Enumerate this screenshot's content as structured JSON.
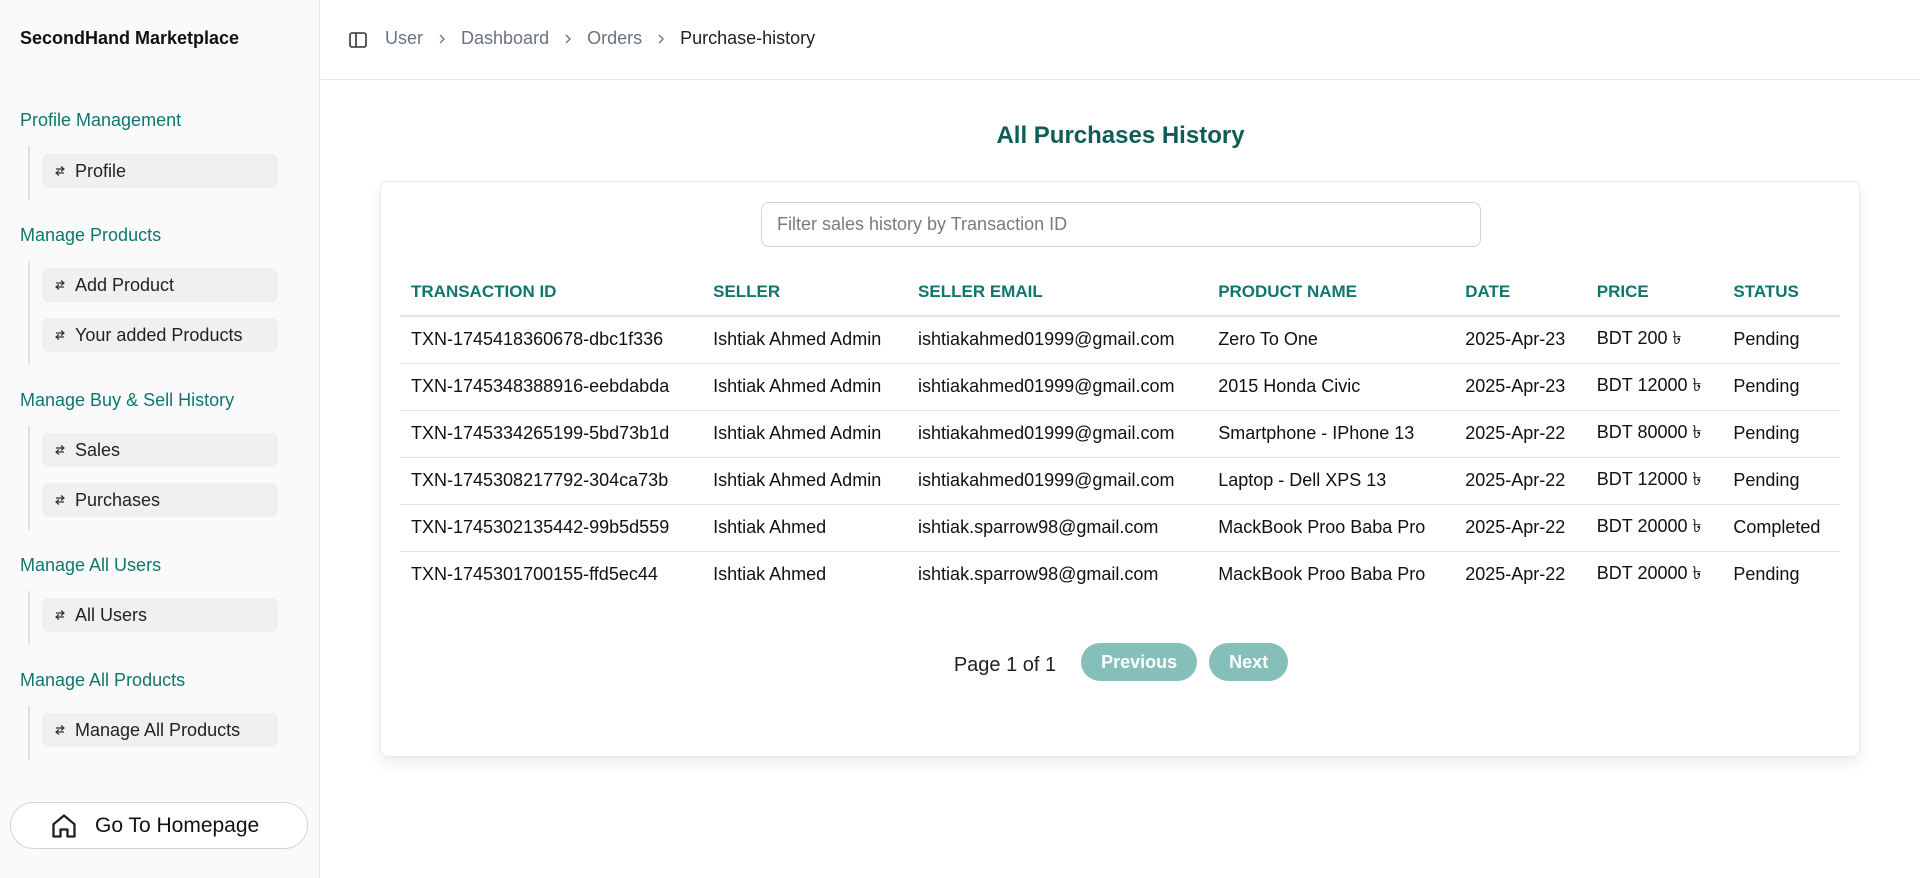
{
  "app": {
    "brand": "SecondHand Marketplace"
  },
  "sidebar": {
    "sections": [
      {
        "title": "Profile Management",
        "items": [
          {
            "label": "Profile"
          }
        ]
      },
      {
        "title": "Manage Products",
        "items": [
          {
            "label": "Add Product"
          },
          {
            "label": "Your added Products"
          }
        ]
      },
      {
        "title": "Manage Buy & Sell History",
        "items": [
          {
            "label": "Sales"
          },
          {
            "label": "Purchases"
          }
        ]
      },
      {
        "title": "Manage All Users",
        "items": [
          {
            "label": "All Users"
          }
        ]
      },
      {
        "title": "Manage All Products",
        "items": [
          {
            "label": "Manage All Products"
          }
        ]
      }
    ],
    "home_button": "Go To Homepage"
  },
  "breadcrumb": [
    "User",
    "Dashboard",
    "Orders",
    "Purchase-history"
  ],
  "main": {
    "title": "All Purchases History",
    "search_placeholder": "Filter sales history by Transaction ID",
    "columns": [
      "TRANSACTION ID",
      "SELLER",
      "SELLER EMAIL",
      "PRODUCT NAME",
      "DATE",
      "PRICE",
      "STATUS"
    ],
    "rows": [
      [
        "TXN-1745418360678-dbc1f336",
        "Ishtiak Ahmed Admin",
        "ishtiakahmed01999@gmail.com",
        "Zero To One",
        "2025-Apr-23",
        "BDT 200 ৳",
        "Pending"
      ],
      [
        "TXN-1745348388916-eebdabda",
        "Ishtiak Ahmed Admin",
        "ishtiakahmed01999@gmail.com",
        "2015 Honda Civic",
        "2025-Apr-23",
        "BDT 12000 ৳",
        "Pending"
      ],
      [
        "TXN-1745334265199-5bd73b1d",
        "Ishtiak Ahmed Admin",
        "ishtiakahmed01999@gmail.com",
        "Smartphone - IPhone 13",
        "2025-Apr-22",
        "BDT 80000 ৳",
        "Pending"
      ],
      [
        "TXN-1745308217792-304ca73b",
        "Ishtiak Ahmed Admin",
        "ishtiakahmed01999@gmail.com",
        "Laptop - Dell XPS 13",
        "2025-Apr-22",
        "BDT 12000 ৳",
        "Pending"
      ],
      [
        "TXN-1745302135442-99b5d559",
        "Ishtiak Ahmed",
        "ishtiak.sparrow98@gmail.com",
        "MackBook Proo Baba Pro",
        "2025-Apr-22",
        "BDT 20000 ৳",
        "Completed"
      ],
      [
        "TXN-1745301700155-ffd5ec44",
        "Ishtiak Ahmed",
        "ishtiak.sparrow98@gmail.com",
        "MackBook Proo Baba Pro",
        "2025-Apr-22",
        "BDT 20000 ৳",
        "Pending"
      ]
    ],
    "pagination": {
      "info": "Page 1 of 1",
      "prev": "Previous",
      "next": "Next"
    }
  },
  "colors": {
    "accent": "#0f766e",
    "title": "#0f5e55",
    "button_disabled": "#86bfb9"
  }
}
